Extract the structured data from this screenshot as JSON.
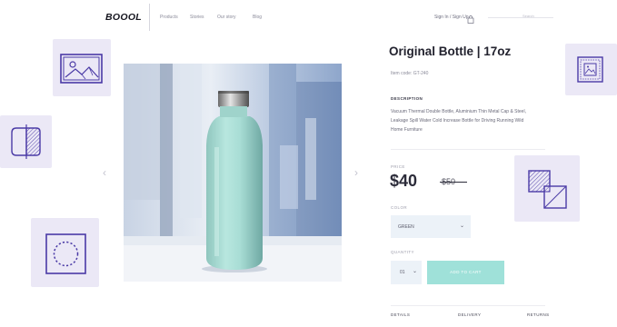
{
  "header": {
    "logo": "BOOOL",
    "nav": [
      "Products",
      "Stories",
      "Our story",
      "Blog"
    ],
    "account": "Sign In / Sign Up",
    "search_placeholder": "Search"
  },
  "product": {
    "title": "Original Bottle | 17oz",
    "subtitle": "Item code: GT-240",
    "description_label": "DESCRIPTION",
    "description_lines": [
      "Vacuum Thermal Double Bottle, Aluminium Thin Metal Cap & Steel,",
      "Leakage Spill Water Cold Increase Bottle for Driving Running Wild",
      "Home Furniture"
    ],
    "price_label": "PRICE",
    "price": "$40",
    "old_price": "$50",
    "color_label": "COLOR",
    "color_value": "GREEN",
    "quantity_label": "QUANTITY",
    "quantity_value": "01",
    "add_to_cart": "ADD TO CART",
    "tabs": [
      "DETAILS",
      "DELIVERY",
      "RETURNS"
    ]
  },
  "colors": {
    "accent": "#9fe1d9",
    "tile": "#ebe8f6",
    "icon_stroke": "#4a3aa6",
    "select_bg": "#ecf2f8"
  },
  "icons": [
    "image-icon",
    "split-square-icon",
    "dotted-circle-icon",
    "framed-image-icon",
    "overlap-squares-icon",
    "bag-icon",
    "chevron-left-icon",
    "chevron-right-icon",
    "chevron-down-icon"
  ]
}
